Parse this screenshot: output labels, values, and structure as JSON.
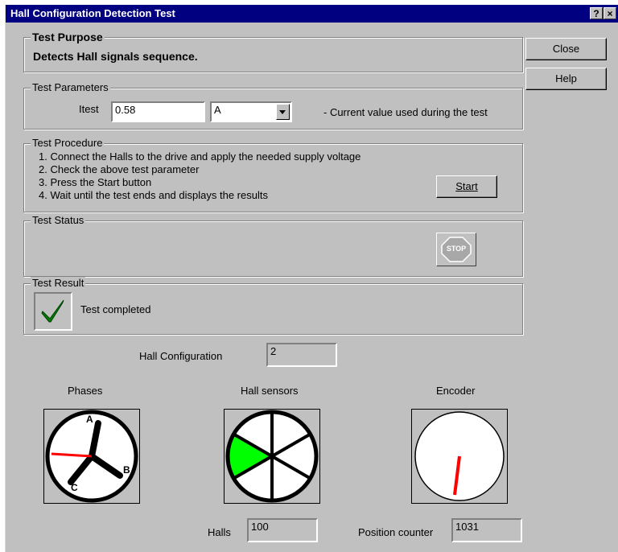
{
  "window": {
    "title": "Hall Configuration Detection Test",
    "help_glyph": "?",
    "close_glyph": "×"
  },
  "buttons": {
    "close": "Close",
    "help": "Help",
    "start": "Start"
  },
  "purpose": {
    "title": "Test Purpose",
    "text": "Detects Hall signals sequence."
  },
  "parameters": {
    "title": "Test Parameters",
    "label": "Itest",
    "value": "0.58",
    "unit": "A",
    "description": "- Current value used during the test"
  },
  "procedure": {
    "title": "Test Procedure",
    "steps": [
      "1. Connect the Halls to the drive and apply the needed supply voltage",
      "2. Check the above test parameter",
      "3. Press the Start button",
      "4. Wait until the test ends and displays the results"
    ]
  },
  "status": {
    "title": "Test Status",
    "stop_label": "STOP"
  },
  "result": {
    "title": "Test Result",
    "text": "Test completed"
  },
  "hall_config": {
    "label": "Hall Configuration",
    "value": "2"
  },
  "panels": {
    "phases": {
      "title": "Phases",
      "labels": [
        "A",
        "B",
        "C"
      ]
    },
    "hall_sensors": {
      "title": "Hall sensors"
    },
    "encoder": {
      "title": "Encoder"
    }
  },
  "halls": {
    "label": "Halls",
    "value": "100"
  },
  "position_counter": {
    "label": "Position counter",
    "value": "1031"
  },
  "colors": {
    "title_bar": "#000080",
    "face": "#c0c0c0",
    "hall_active": "#00ff00",
    "needle": "#ff0000",
    "check": "#008000"
  }
}
